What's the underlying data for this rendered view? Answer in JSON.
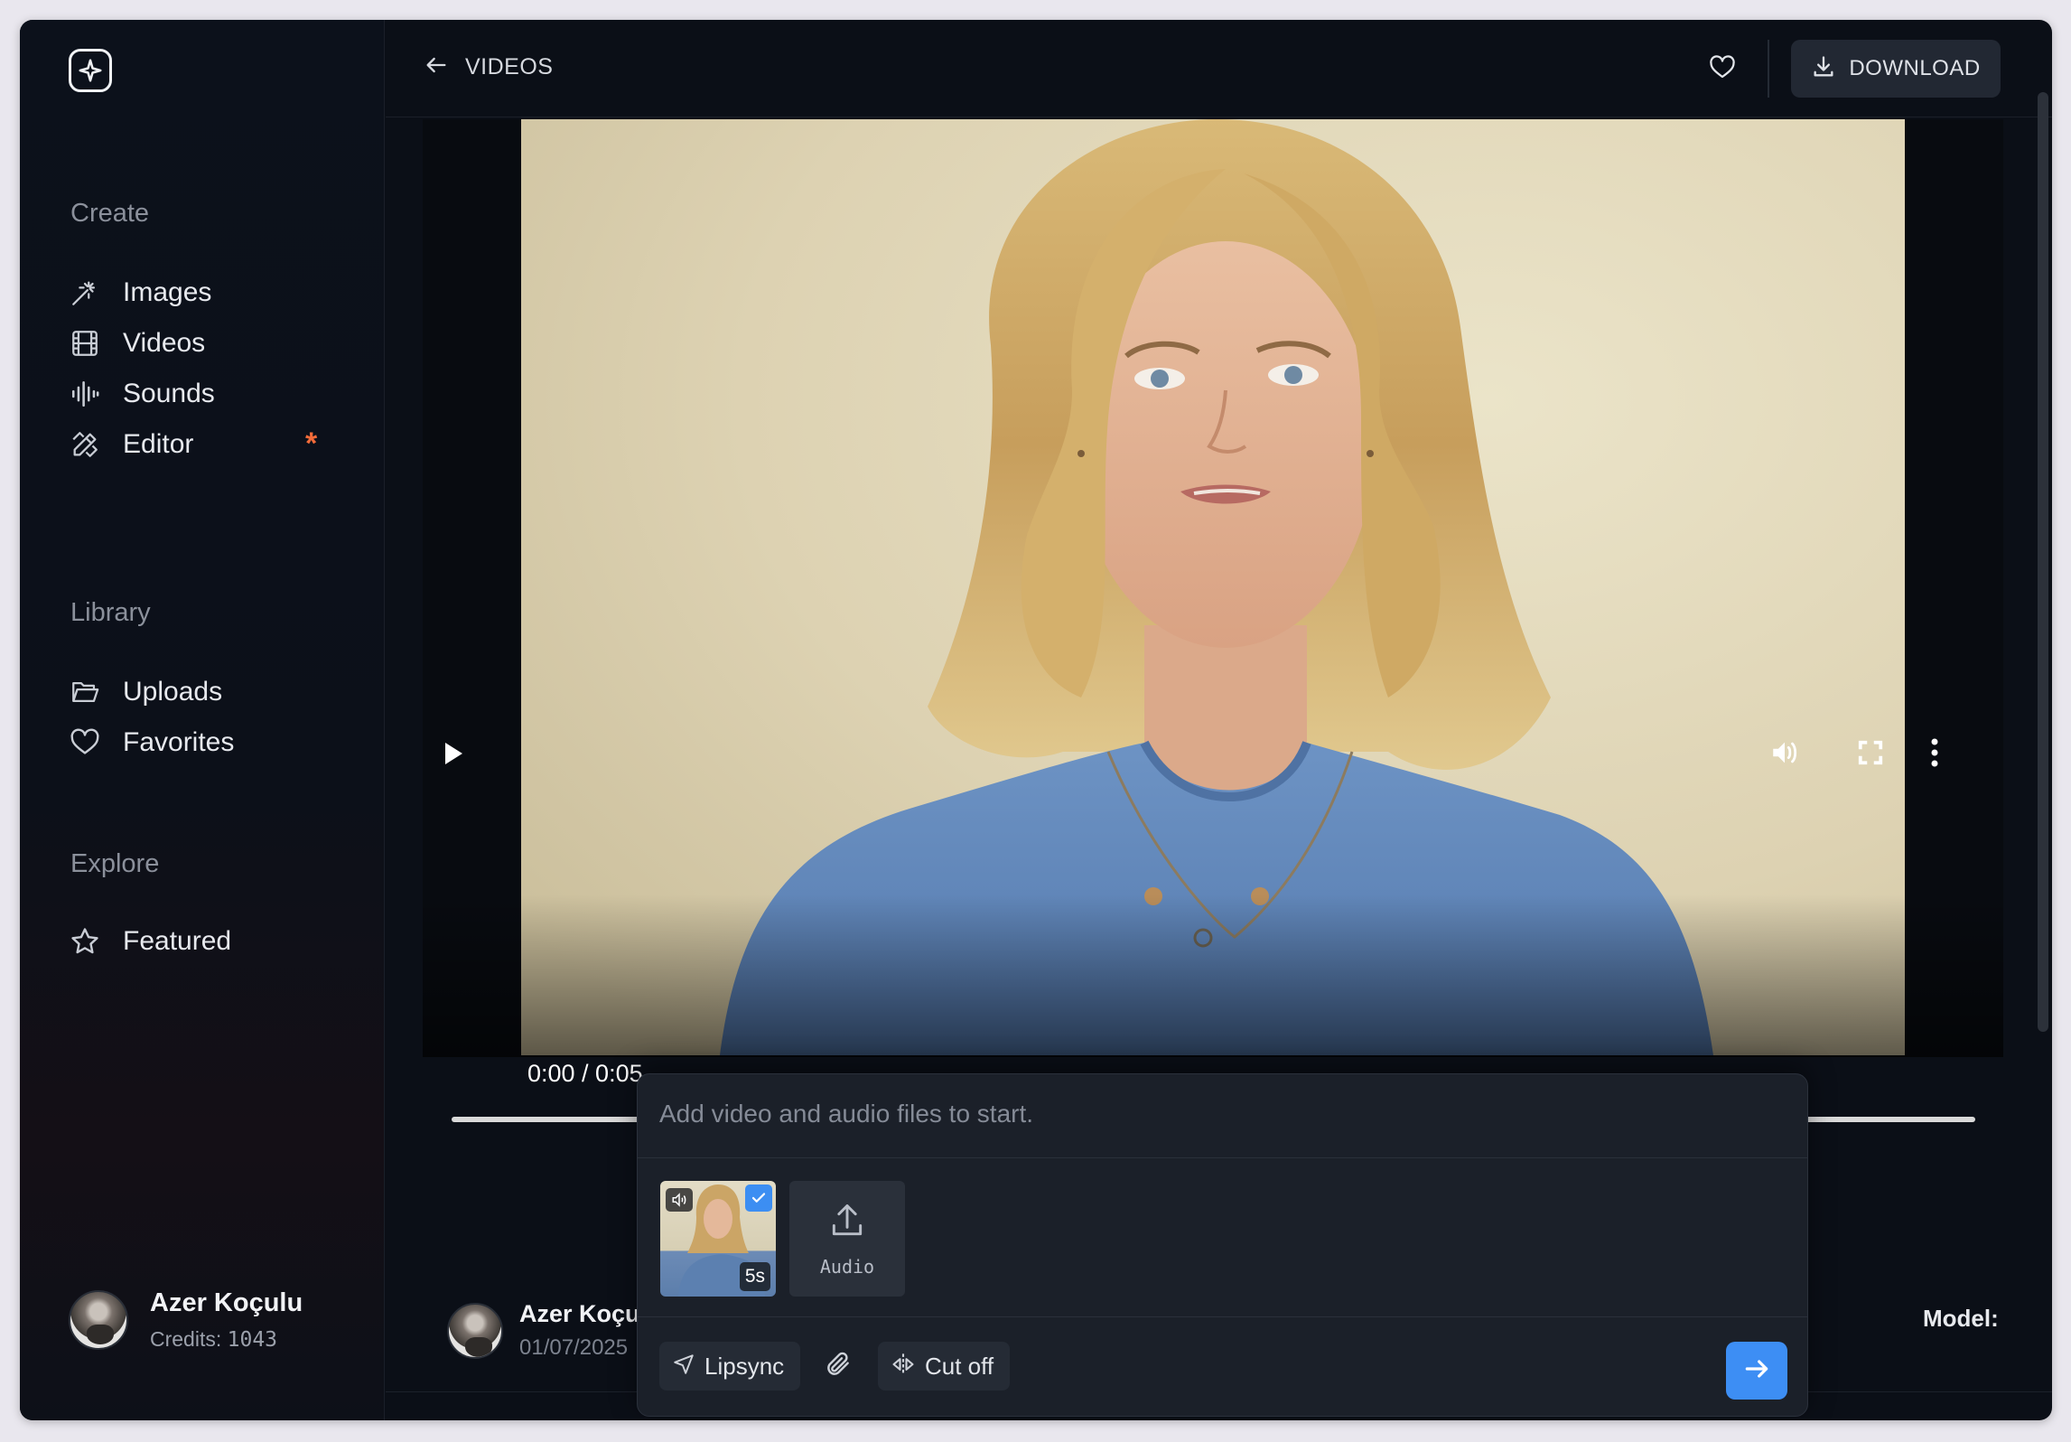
{
  "sidebar": {
    "sections": {
      "create": "Create",
      "library": "Library",
      "explore": "Explore"
    },
    "items": {
      "images": "Images",
      "videos": "Videos",
      "sounds": "Sounds",
      "editor": "Editor",
      "editor_badge": "*",
      "uploads": "Uploads",
      "favorites": "Favorites",
      "featured": "Featured"
    },
    "user": {
      "name": "Azer Koçulu",
      "credits_label": "Credits:",
      "credits_value": "1043"
    }
  },
  "header": {
    "back_label": "VIDEOS",
    "download_label": "DOWNLOAD"
  },
  "player": {
    "time": "0:00 / 0:05",
    "progress": 0
  },
  "details": {
    "author_name": "Azer Koçulu",
    "date": "01/07/2025",
    "model_label": "Model:"
  },
  "panel": {
    "placeholder": "Add video and audio files to start.",
    "thumb_duration": "5s",
    "audio_label": "Audio",
    "lipsync_label": "Lipsync",
    "cutoff_label": "Cut off"
  },
  "colors": {
    "accent": "#3d8ef4",
    "badge": "#f26b3a",
    "background": "#0b0f17"
  }
}
